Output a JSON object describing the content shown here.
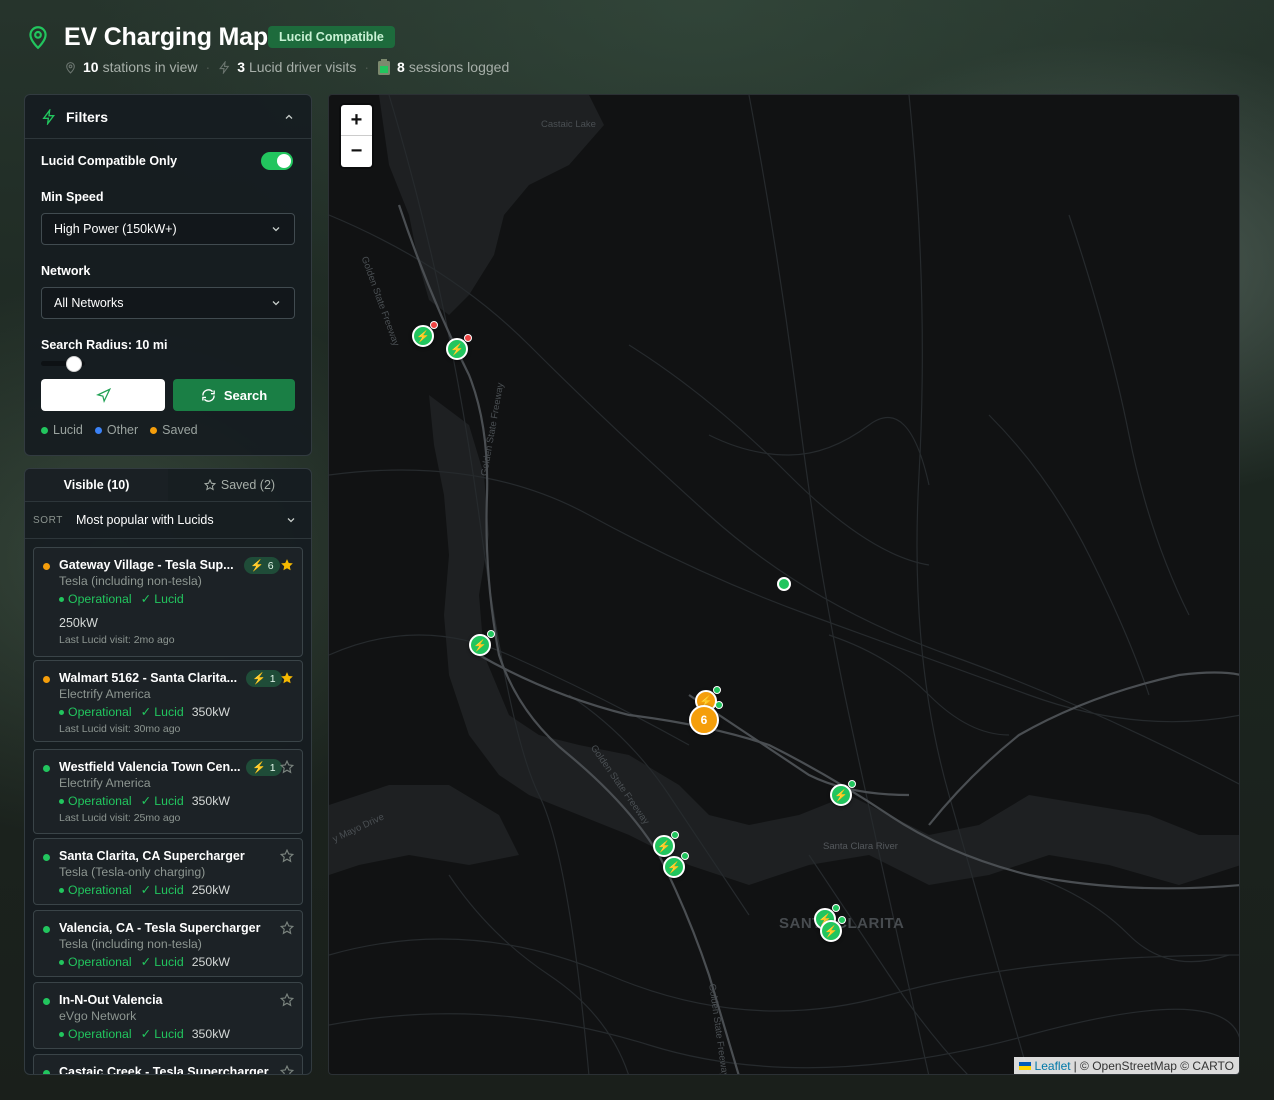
{
  "header": {
    "title": "EV Charging Map",
    "badge": "Lucid Compatible",
    "stats": [
      {
        "value": "10",
        "label": "stations in view"
      },
      {
        "value": "3",
        "label": "Lucid driver visits"
      },
      {
        "value": "8",
        "label": "sessions logged"
      }
    ]
  },
  "filters": {
    "title": "Filters",
    "lucid_only_label": "Lucid Compatible Only",
    "lucid_only_enabled": true,
    "min_speed_label": "Min Speed",
    "min_speed_value": "High Power (150kW+)",
    "network_label": "Network",
    "network_value": "All Networks",
    "radius_label": "Search Radius: 10 mi",
    "radius_level": 0.35,
    "search_button": "Search",
    "legend": [
      {
        "label": "Lucid",
        "color": "#22c55e"
      },
      {
        "label": "Other",
        "color": "#3b82f6"
      },
      {
        "label": "Saved",
        "color": "#f59e0b"
      }
    ]
  },
  "list": {
    "tabs": [
      "Visible (10)",
      "Saved (2)"
    ],
    "sort_key": "SORT",
    "sort_value": "Most popular with Lucids",
    "stations": [
      {
        "name": "Gateway Village - Tesla Sup...",
        "network": "Tesla (including non-tesla)",
        "status": "Operational",
        "lucid": "✓ Lucid",
        "power": "250kW",
        "visit": "Last Lucid visit: 2mo ago",
        "visits": "6",
        "saved": true
      },
      {
        "name": "Walmart 5162 - Santa Clarita...",
        "network": "Electrify America",
        "status": "Operational",
        "lucid": "✓ Lucid",
        "power": "350kW",
        "visit": "Last Lucid visit: 30mo ago",
        "visits": "1",
        "saved": true
      },
      {
        "name": "Westfield Valencia Town Cen...",
        "network": "Electrify America",
        "status": "Operational",
        "lucid": "✓ Lucid",
        "power": "350kW",
        "visit": "Last Lucid visit: 25mo ago",
        "visits": "1",
        "saved": false
      },
      {
        "name": "Santa Clarita, CA Supercharger",
        "network": "Tesla (Tesla-only charging)",
        "status": "Operational",
        "lucid": "✓ Lucid",
        "power": "250kW",
        "saved": false
      },
      {
        "name": "Valencia, CA - Tesla Supercharger",
        "network": "Tesla (including non-tesla)",
        "status": "Operational",
        "lucid": "✓ Lucid",
        "power": "250kW",
        "saved": false
      },
      {
        "name": "In-N-Out Valencia",
        "network": "eVgo Network",
        "status": "Operational",
        "lucid": "✓ Lucid",
        "power": "350kW",
        "saved": false
      },
      {
        "name": "Castaic Creek - Tesla Supercharger",
        "saved": false
      }
    ]
  },
  "map": {
    "zoom_in": "+",
    "zoom_out": "−",
    "cluster_count": "6",
    "labels": [
      "Castaic Lake",
      "Golden State Freeway",
      "Golden State Freeway",
      "Golden State Freeway",
      "Golden State Freeway",
      "Santa Clara River",
      "SANTA CLARITA",
      "y Mayo Drive"
    ],
    "attribution_link": "Leaflet",
    "attribution_text": "| © OpenStreetMap © CARTO"
  }
}
